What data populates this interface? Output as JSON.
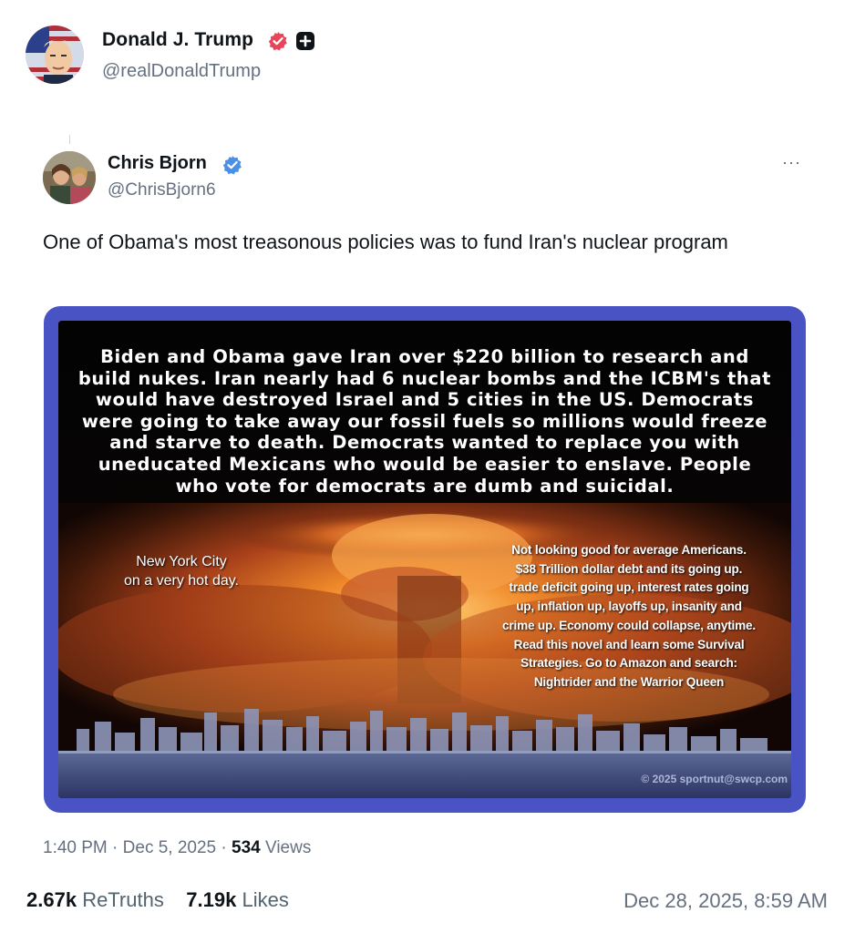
{
  "author": {
    "name": "Donald J. Trump",
    "handle": "@realDonaldTrump",
    "verified_icon": "verified-badge-red",
    "extra_icon": "plus-square-icon"
  },
  "quoted": {
    "name": "Chris Bjorn",
    "handle": "@ChrisBjorn6",
    "verified_icon": "verified-badge-blue",
    "more_label": "···",
    "text": "One of Obama's most treasonous policies was to fund Iran's nuclear program"
  },
  "media": {
    "headline": "Biden and Obama gave Iran over $220 billion to research and build nukes. Iran nearly had 6 nuclear bombs and the ICBM's that would have destroyed Israel and 5 cities in the US. Democrats were going to take away our fossil fuels so millions would freeze and starve to death. Democrats wanted to replace you with uneducated Mexicans who would be easier to enslave. People who vote for democrats are dumb and suicidal.",
    "left_caption_1": "New York City",
    "left_caption_2": "on a very hot day.",
    "right_caption": [
      "Not looking good for average Americans.",
      "$38 Trillion dollar debt and its going up.",
      "trade deficit going up, interest rates going",
      "up, inflation up, layoffs up, insanity and",
      "crime up. Economy could collapse, anytime.",
      "Read this novel and learn some Survival",
      "Strategies. Go to Amazon and search:",
      "Nightrider and the Warrior Queen"
    ],
    "copyright": "© 2025 sportnut@swcp.com",
    "frame_color": "#4a53c4"
  },
  "meta": {
    "time": "1:40 PM",
    "sep1": "·",
    "date": "Dec 5, 2025",
    "sep2": "·",
    "views_count": "534",
    "views_label": "Views"
  },
  "stats": {
    "retruths_count": "2.67k",
    "retruths_label": "ReTruths",
    "likes_count": "7.19k",
    "likes_label": "Likes",
    "share_date": "Dec 28, 2025, 8:59 AM"
  }
}
